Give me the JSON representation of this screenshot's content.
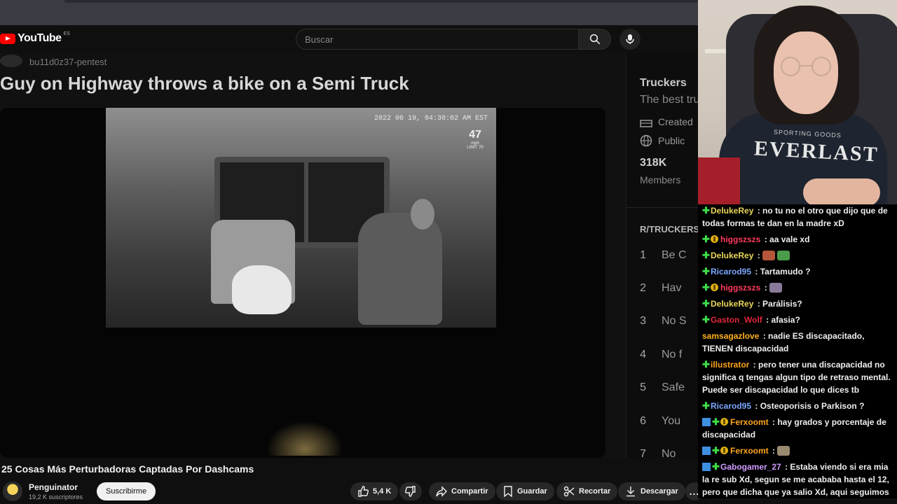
{
  "youtube": {
    "logo_text": "YouTube",
    "region": "ES",
    "search_placeholder": "Buscar"
  },
  "video_frame": {
    "subtitle": "bu11d0z37-pentest",
    "title": "Guy on Highway throws a bike on a Semi Truck",
    "timestamp": "2022 06 19, 04:30:02 AM EST",
    "speed_value": "47",
    "speed_unit": "mph",
    "speed_limit": "LIMIT 70"
  },
  "side_panel": {
    "title": "Truckers",
    "description": "The best tru",
    "created_label": "Created",
    "visibility_label": "Public",
    "members_value": "318K",
    "members_label": "Members",
    "section_title": "R/TRUCKERS",
    "rank_items": [
      {
        "n": "1",
        "t": "Be C"
      },
      {
        "n": "2",
        "t": "Hav"
      },
      {
        "n": "3",
        "t": "No S"
      },
      {
        "n": "4",
        "t": "No f"
      },
      {
        "n": "5",
        "t": "Safe"
      },
      {
        "n": "6",
        "t": "You"
      },
      {
        "n": "7",
        "t": "No"
      }
    ]
  },
  "video_info": {
    "title": "25 Cosas Más Perturbadoras Captadas Por Dashcams",
    "channel_name": "Penguinator",
    "subscribers": "19,2 K suscriptores",
    "subscribe_label": "Suscribirme",
    "like_count": "5,4 K",
    "share_label": "Compartir",
    "save_label": "Guardar",
    "clip_label": "Recortar",
    "download_label": "Descargar",
    "more_label": "..."
  },
  "webcam": {
    "hoodie_text": "EVERLAST",
    "hoodie_small_text": "SPORTING GOODS"
  },
  "chat": {
    "messages": [
      {
        "badges": [
          "plus"
        ],
        "user": "DelukeRey",
        "color": "#e9d65a",
        "text": ": no tu no el otro que dijo que de todas formas te dan en la madre xD"
      },
      {
        "badges": [
          "plus",
          "gold"
        ],
        "user": "higgszszs",
        "color": "#ff3b5c",
        "text": ": aa vale xd"
      },
      {
        "badges": [
          "plus"
        ],
        "user": "DelukeRey",
        "color": "#e9d65a",
        "text": ":",
        "emotes": [
          "#b5563a",
          "#4a9b4a"
        ]
      },
      {
        "badges": [
          "plus"
        ],
        "user": "Ricarod95",
        "color": "#7aa7ff",
        "text": ": Tartamudo ?"
      },
      {
        "badges": [
          "plus",
          "gold"
        ],
        "user": "higgszszs",
        "color": "#ff3b5c",
        "text": ":",
        "emotes": [
          "#8a7a9a"
        ]
      },
      {
        "badges": [
          "plus"
        ],
        "user": "DelukeRey",
        "color": "#e9d65a",
        "text": ": Parálisis?"
      },
      {
        "badges": [
          "plus"
        ],
        "user": "Gaston_Wolf",
        "color": "#e0283c",
        "text": ": afasia?"
      },
      {
        "badges": [],
        "user": "samsagazlove",
        "color": "#ffb21e",
        "text": ": nadie ES discapacitado, TIENEN discapacidad"
      },
      {
        "badges": [
          "plus"
        ],
        "user": "illustrator",
        "color": "#ffa41e",
        "text": ": pero tener una discapacidad no significa q tengas algun tipo de retraso mental. Puede ser discapacidad lo que dices tb"
      },
      {
        "badges": [
          "plus"
        ],
        "user": "Ricarod95",
        "color": "#7aa7ff",
        "text": ": Osteoporisis o Parkison ?"
      },
      {
        "badges": [
          "blue",
          "plus",
          "gold"
        ],
        "user": "Ferxoomt",
        "color": "#ffa41e",
        "text": ": hay grados y porcentaje de discapacidad"
      },
      {
        "badges": [
          "blue",
          "plus",
          "gold"
        ],
        "user": "Ferxoomt",
        "color": "#ffa41e",
        "text": ":",
        "emotes": [
          "#9a8a70"
        ]
      },
      {
        "badges": [
          "blue",
          "plus"
        ],
        "user": "Gabogamer_27",
        "color": "#cf9bff",
        "text": ": Estaba viendo si era mia la re sub Xd, segun se me acababa hasta el 12, pero que dicha que ya salio Xd, aqui seguimos Faunitis"
      }
    ]
  }
}
